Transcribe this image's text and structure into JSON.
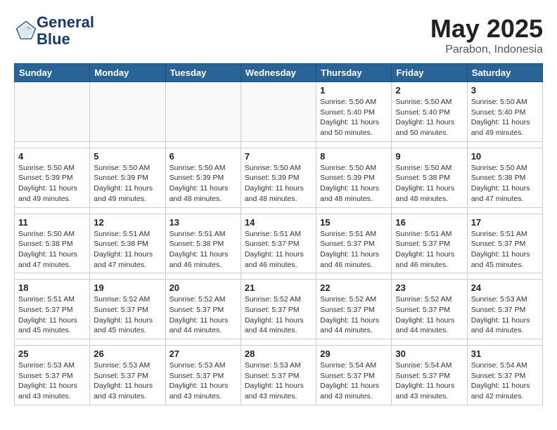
{
  "logo": {
    "line1": "General",
    "line2": "Blue"
  },
  "title": "May 2025",
  "subtitle": "Parabon, Indonesia",
  "weekdays": [
    "Sunday",
    "Monday",
    "Tuesday",
    "Wednesday",
    "Thursday",
    "Friday",
    "Saturday"
  ],
  "weeks": [
    [
      {
        "day": "",
        "info": ""
      },
      {
        "day": "",
        "info": ""
      },
      {
        "day": "",
        "info": ""
      },
      {
        "day": "",
        "info": ""
      },
      {
        "day": "1",
        "info": "Sunrise: 5:50 AM\nSunset: 5:40 PM\nDaylight: 11 hours\nand 50 minutes."
      },
      {
        "day": "2",
        "info": "Sunrise: 5:50 AM\nSunset: 5:40 PM\nDaylight: 11 hours\nand 50 minutes."
      },
      {
        "day": "3",
        "info": "Sunrise: 5:50 AM\nSunset: 5:40 PM\nDaylight: 11 hours\nand 49 minutes."
      }
    ],
    [
      {
        "day": "4",
        "info": "Sunrise: 5:50 AM\nSunset: 5:39 PM\nDaylight: 11 hours\nand 49 minutes."
      },
      {
        "day": "5",
        "info": "Sunrise: 5:50 AM\nSunset: 5:39 PM\nDaylight: 11 hours\nand 49 minutes."
      },
      {
        "day": "6",
        "info": "Sunrise: 5:50 AM\nSunset: 5:39 PM\nDaylight: 11 hours\nand 48 minutes."
      },
      {
        "day": "7",
        "info": "Sunrise: 5:50 AM\nSunset: 5:39 PM\nDaylight: 11 hours\nand 48 minutes."
      },
      {
        "day": "8",
        "info": "Sunrise: 5:50 AM\nSunset: 5:39 PM\nDaylight: 11 hours\nand 48 minutes."
      },
      {
        "day": "9",
        "info": "Sunrise: 5:50 AM\nSunset: 5:38 PM\nDaylight: 11 hours\nand 48 minutes."
      },
      {
        "day": "10",
        "info": "Sunrise: 5:50 AM\nSunset: 5:38 PM\nDaylight: 11 hours\nand 47 minutes."
      }
    ],
    [
      {
        "day": "11",
        "info": "Sunrise: 5:50 AM\nSunset: 5:38 PM\nDaylight: 11 hours\nand 47 minutes."
      },
      {
        "day": "12",
        "info": "Sunrise: 5:51 AM\nSunset: 5:38 PM\nDaylight: 11 hours\nand 47 minutes."
      },
      {
        "day": "13",
        "info": "Sunrise: 5:51 AM\nSunset: 5:38 PM\nDaylight: 11 hours\nand 46 minutes."
      },
      {
        "day": "14",
        "info": "Sunrise: 5:51 AM\nSunset: 5:37 PM\nDaylight: 11 hours\nand 46 minutes."
      },
      {
        "day": "15",
        "info": "Sunrise: 5:51 AM\nSunset: 5:37 PM\nDaylight: 11 hours\nand 46 minutes."
      },
      {
        "day": "16",
        "info": "Sunrise: 5:51 AM\nSunset: 5:37 PM\nDaylight: 11 hours\nand 46 minutes."
      },
      {
        "day": "17",
        "info": "Sunrise: 5:51 AM\nSunset: 5:37 PM\nDaylight: 11 hours\nand 45 minutes."
      }
    ],
    [
      {
        "day": "18",
        "info": "Sunrise: 5:51 AM\nSunset: 5:37 PM\nDaylight: 11 hours\nand 45 minutes."
      },
      {
        "day": "19",
        "info": "Sunrise: 5:52 AM\nSunset: 5:37 PM\nDaylight: 11 hours\nand 45 minutes."
      },
      {
        "day": "20",
        "info": "Sunrise: 5:52 AM\nSunset: 5:37 PM\nDaylight: 11 hours\nand 44 minutes."
      },
      {
        "day": "21",
        "info": "Sunrise: 5:52 AM\nSunset: 5:37 PM\nDaylight: 11 hours\nand 44 minutes."
      },
      {
        "day": "22",
        "info": "Sunrise: 5:52 AM\nSunset: 5:37 PM\nDaylight: 11 hours\nand 44 minutes."
      },
      {
        "day": "23",
        "info": "Sunrise: 5:52 AM\nSunset: 5:37 PM\nDaylight: 11 hours\nand 44 minutes."
      },
      {
        "day": "24",
        "info": "Sunrise: 5:53 AM\nSunset: 5:37 PM\nDaylight: 11 hours\nand 44 minutes."
      }
    ],
    [
      {
        "day": "25",
        "info": "Sunrise: 5:53 AM\nSunset: 5:37 PM\nDaylight: 11 hours\nand 43 minutes."
      },
      {
        "day": "26",
        "info": "Sunrise: 5:53 AM\nSunset: 5:37 PM\nDaylight: 11 hours\nand 43 minutes."
      },
      {
        "day": "27",
        "info": "Sunrise: 5:53 AM\nSunset: 5:37 PM\nDaylight: 11 hours\nand 43 minutes."
      },
      {
        "day": "28",
        "info": "Sunrise: 5:53 AM\nSunset: 5:37 PM\nDaylight: 11 hours\nand 43 minutes."
      },
      {
        "day": "29",
        "info": "Sunrise: 5:54 AM\nSunset: 5:37 PM\nDaylight: 11 hours\nand 43 minutes."
      },
      {
        "day": "30",
        "info": "Sunrise: 5:54 AM\nSunset: 5:37 PM\nDaylight: 11 hours\nand 43 minutes."
      },
      {
        "day": "31",
        "info": "Sunrise: 5:54 AM\nSunset: 5:37 PM\nDaylight: 11 hours\nand 42 minutes."
      }
    ]
  ]
}
